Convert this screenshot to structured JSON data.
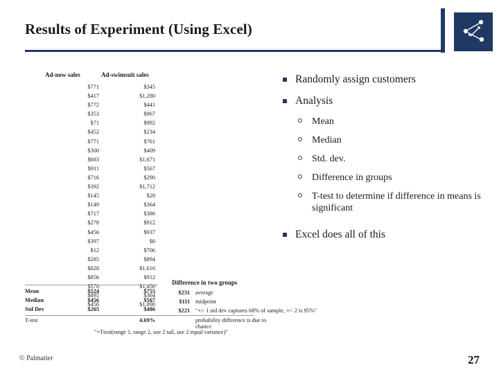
{
  "slide": {
    "title": "Results of Experiment (Using Excel)",
    "credit": "© Palmatier",
    "page_number": "27",
    "accent_color": "#1f3864"
  },
  "spreadsheet": {
    "headers": [
      "Ad-now sales",
      "Ad-swimsuit sales"
    ],
    "ad_now": [
      "$771",
      "$417",
      "$772",
      "$353",
      "$71",
      "$452",
      "$771",
      "$300",
      "$683",
      "$911",
      "$716",
      "$392",
      "$145",
      "$149",
      "$717",
      "$278",
      "$456",
      "$397",
      "$12",
      "$285",
      "$828",
      "$856",
      "$570",
      "$895",
      "$456"
    ],
    "ad_swimsuit": [
      "$345",
      "$1,280",
      "$441",
      "$967",
      "$992",
      "$234",
      "$761",
      "$409",
      "$1,671",
      "$567",
      "$290",
      "$1,712",
      "$28",
      "$364",
      "$386",
      "$912",
      "$937",
      "$0",
      "$706",
      "$894",
      "$1,616",
      "$912",
      "$1,450",
      "$364",
      "$1,090"
    ],
    "stats": [
      {
        "label": "Mean",
        "ad_now": "$524",
        "ad_swimsuit": "$755"
      },
      {
        "label": "Median",
        "ad_now": "$456",
        "ad_swimsuit": "$567"
      },
      {
        "label": "Std Dev",
        "ad_now": "$265",
        "ad_swimsuit": "$486"
      }
    ],
    "difference_header": "Difference in two groups",
    "difference_rows": [
      {
        "amount": "$231",
        "description": "average"
      },
      {
        "amount": "$111",
        "description": "midpoint"
      },
      {
        "amount": "$221",
        "description": "\"+/- 1 std dev captures 68% of sample, +/- 2 is 95%\""
      }
    ],
    "ttest": {
      "label": "T-test",
      "value": "4.69%",
      "note": "probability difference is due to chance"
    },
    "formula": "\"=Ttest(range 1, range 2, use 2 tail, use 2 equal variance)\""
  },
  "bullets": {
    "items": [
      {
        "level": 1,
        "text": "Randomly assign customers"
      },
      {
        "level": 1,
        "text": "Analysis"
      },
      {
        "level": 2,
        "text": "Mean"
      },
      {
        "level": 2,
        "text": "Median"
      },
      {
        "level": 2,
        "text": "Std. dev."
      },
      {
        "level": 2,
        "text": "Difference in groups"
      },
      {
        "level": 2,
        "text": "T-test to determine if difference in means is significant"
      },
      {
        "level": 1,
        "text": "Excel does all of this"
      }
    ]
  }
}
